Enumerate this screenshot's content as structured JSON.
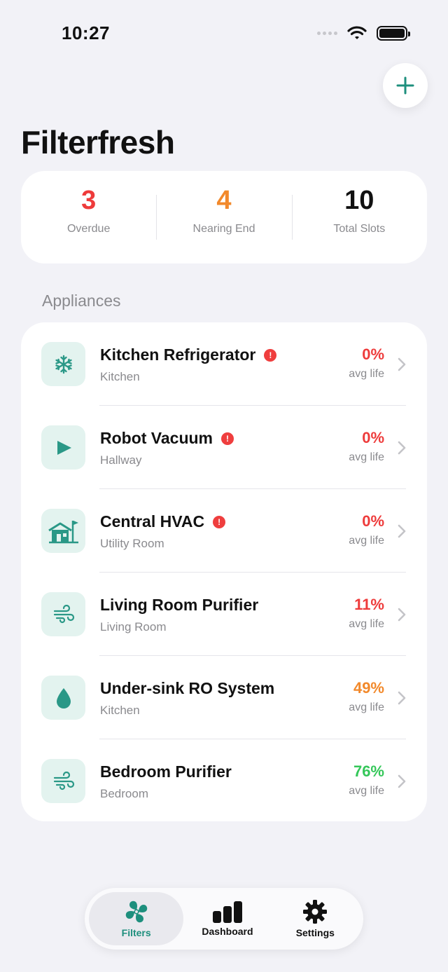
{
  "status_bar": {
    "time": "10:27"
  },
  "header": {
    "title": "Filterfresh"
  },
  "summary": [
    {
      "value": "3",
      "label": "Overdue",
      "color": "#ee3b3b"
    },
    {
      "value": "4",
      "label": "Nearing End",
      "color": "#f2892b"
    },
    {
      "value": "10",
      "label": "Total Slots",
      "color": "#111111"
    }
  ],
  "section": {
    "title": "Appliances"
  },
  "appliances": [
    {
      "name": "Kitchen Refrigerator",
      "room": "Kitchen",
      "life": "0%",
      "life_label": "avg life",
      "icon": "snowflake-icon",
      "alert": true,
      "life_color": "#ee3b3b"
    },
    {
      "name": "Robot Vacuum",
      "room": "Hallway",
      "life": "0%",
      "life_label": "avg life",
      "icon": "play-icon",
      "alert": true,
      "life_color": "#ee3b3b"
    },
    {
      "name": "Central HVAC",
      "room": "Utility Room",
      "life": "0%",
      "life_label": "avg life",
      "icon": "house-flag-icon",
      "alert": true,
      "life_color": "#ee3b3b"
    },
    {
      "name": "Living Room Purifier",
      "room": "Living Room",
      "life": "11%",
      "life_label": "avg life",
      "icon": "wind-icon",
      "alert": false,
      "life_color": "#ee3b3b"
    },
    {
      "name": "Under-sink RO System",
      "room": "Kitchen",
      "life": "49%",
      "life_label": "avg life",
      "icon": "drop-icon",
      "alert": false,
      "life_color": "#f2892b"
    },
    {
      "name": "Bedroom Purifier",
      "room": "Bedroom",
      "life": "76%",
      "life_label": "avg life",
      "icon": "wind-icon",
      "alert": false,
      "life_color": "#34c759"
    }
  ],
  "alert_glyph": "!",
  "tabs": [
    {
      "label": "Filters",
      "icon": "fan-icon",
      "active": true
    },
    {
      "label": "Dashboard",
      "icon": "bar-chart-icon",
      "active": false
    },
    {
      "label": "Settings",
      "icon": "gear-icon",
      "active": false
    }
  ],
  "colors": {
    "accent": "#1e8f7d",
    "icon_bg": "#e3f3ef",
    "background": "#f2f2f7"
  }
}
